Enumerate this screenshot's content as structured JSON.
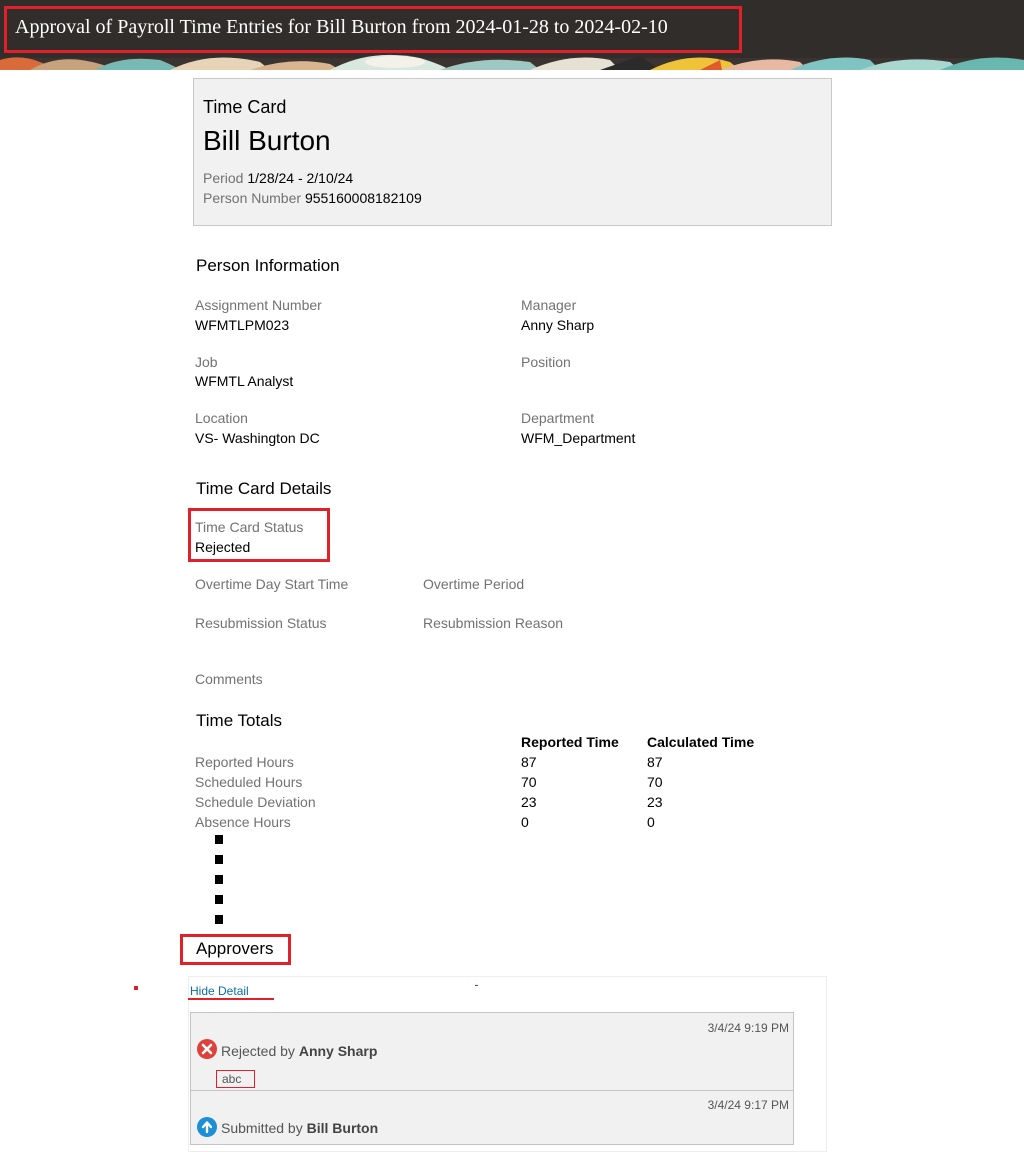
{
  "page": {
    "title": "Approval of Payroll Time Entries for Bill Burton from 2024-01-28 to 2024-02-10"
  },
  "time_card": {
    "label": "Time Card",
    "name": "Bill Burton",
    "period_label": "Period",
    "period_value": "1/28/24 - 2/10/24",
    "person_number_label": "Person Number",
    "person_number_value": "955160008182109"
  },
  "person_info": {
    "title": "Person Information",
    "assignment_number": {
      "label": "Assignment Number",
      "value": "WFMTLPM023"
    },
    "manager": {
      "label": "Manager",
      "value": "Anny Sharp"
    },
    "job": {
      "label": "Job",
      "value": "WFMTL Analyst"
    },
    "position": {
      "label": "Position",
      "value": ""
    },
    "location": {
      "label": "Location",
      "value": "VS- Washington DC"
    },
    "department": {
      "label": "Department",
      "value": "WFM_Department"
    }
  },
  "details": {
    "title": "Time Card Details",
    "status_label": "Time Card Status",
    "status_value": "Rejected",
    "overtime_day_start_label": "Overtime Day Start Time",
    "overtime_period_label": "Overtime Period",
    "resubmission_status_label": "Resubmission Status",
    "resubmission_reason_label": "Resubmission Reason",
    "comments_label": "Comments"
  },
  "totals": {
    "title": "Time Totals",
    "columns": [
      "Reported Time",
      "Calculated Time"
    ],
    "rows": [
      {
        "label": "Reported Hours",
        "reported": "87",
        "calculated": "87"
      },
      {
        "label": "Scheduled Hours",
        "reported": "70",
        "calculated": "70"
      },
      {
        "label": "Schedule Deviation",
        "reported": "23",
        "calculated": "23"
      },
      {
        "label": "Absence Hours",
        "reported": "0",
        "calculated": "0"
      }
    ]
  },
  "approvers": {
    "title": "Approvers",
    "hide_detail_label": "Hide Detail",
    "entries": [
      {
        "timestamp": "3/4/24 9:19 PM",
        "action": "Rejected by",
        "person": "Anny Sharp",
        "comment": "abc",
        "icon": "rejected-x-icon",
        "icon_color": "#e0403a"
      },
      {
        "timestamp": "3/4/24 9:17 PM",
        "action": "Submitted by",
        "person": "Bill Burton",
        "icon": "submitted-arrow-icon",
        "icon_color": "#1c8fd6"
      }
    ]
  },
  "colors": {
    "banner_bg": "#312d2a",
    "highlight_red": "#e2202a",
    "link_blue": "#0a6ea3"
  }
}
